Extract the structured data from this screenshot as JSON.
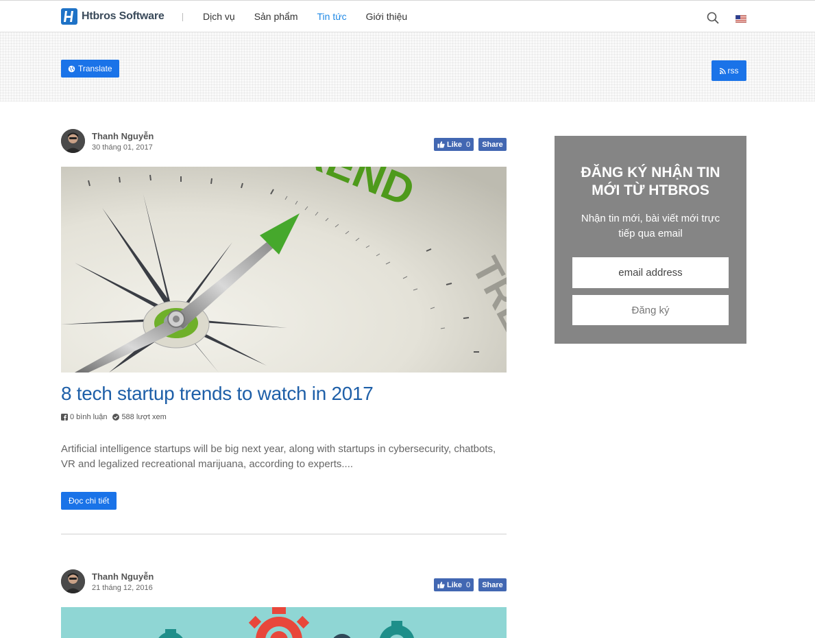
{
  "header": {
    "logo_text": "Htbros Software",
    "nav": [
      "Dịch vụ",
      "Sản phẩm",
      "Tin tức",
      "Giới thiệu"
    ],
    "active_nav": "Tin tức",
    "icons": [
      "search-icon",
      "us-flag-icon"
    ]
  },
  "banner": {
    "translate_label": "Translate",
    "rss_label": "rss"
  },
  "posts": [
    {
      "author": "Thanh Nguyễn",
      "date": "30 tháng 01, 2017",
      "like_label": "Like",
      "like_count": "0",
      "share_label": "Share",
      "image_text": "TREND",
      "title": "8 tech startup trends to watch in 2017",
      "comments": "0 bình luận",
      "views": "588 lượt xem",
      "excerpt": "Artificial intelligence startups will be big next year, along with startups in cybersecurity, chatbots, VR and legalized recreational marijuana, according to experts....",
      "read_more": "Đọc chi tiết"
    },
    {
      "author": "Thanh Nguyễn",
      "date": "21 tháng 12, 2016",
      "like_label": "Like",
      "like_count": "0",
      "share_label": "Share"
    }
  ],
  "sidebar": {
    "title": "ĐĂNG KÝ NHẬN TIN MỚI TỪ HTBROS",
    "description": "Nhận tin mới, bài viết mới trực tiếp qua email",
    "email_placeholder": "email address",
    "submit_label": "Đăng ký"
  },
  "colors": {
    "accent": "#1a73e8",
    "title_blue": "#1e5fa8",
    "facebook": "#4267b2",
    "sidebar_bg": "#858585"
  }
}
